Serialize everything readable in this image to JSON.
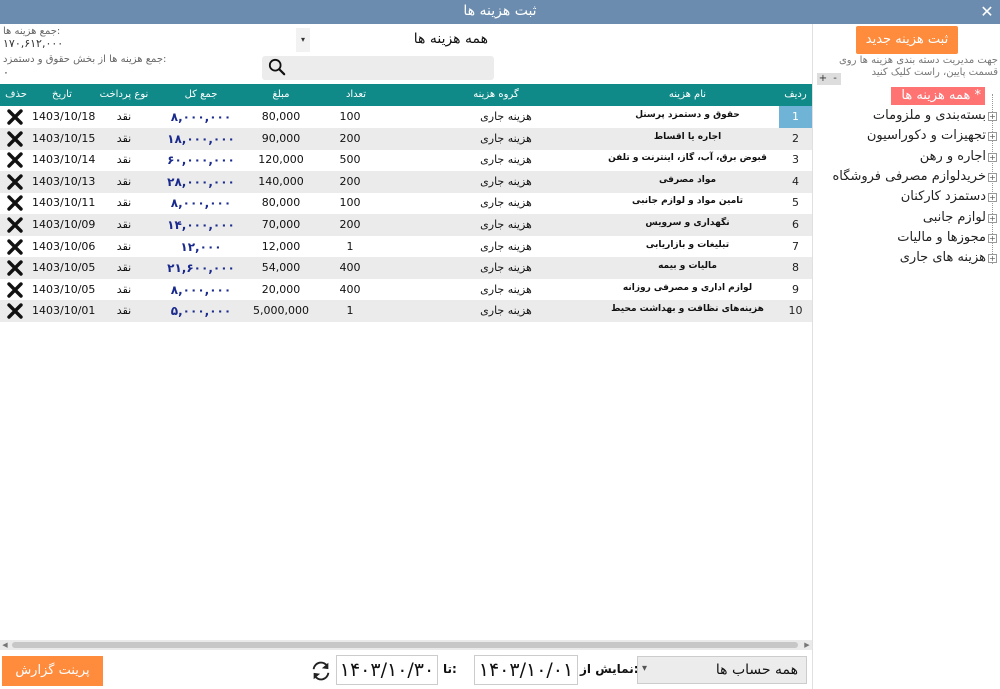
{
  "window": {
    "title": "ثبت هزینه ها",
    "close": "✕"
  },
  "stats": {
    "total_label": "جمع هزینه ها:",
    "total_value": "۱۷۰,۶۱۲,۰۰۰",
    "payroll_label": "جمع هزینه ها از بخش حقوق و دستمزد:",
    "payroll_value": "۰"
  },
  "filter": {
    "selected": "همه هزینه ها",
    "arrow": "▾"
  },
  "search": {
    "value": ""
  },
  "sidebar": {
    "new_button": "ثبت هزینه جدید",
    "hint": "جهت مدیریت دسته بندی هزینه ها روی قسمت پایین، راست کلیک کنید",
    "plus": "+",
    "minus": "-",
    "root": "* همه هزینه ها *",
    "items": [
      "بسته‌بندی و ملزومات",
      "تجهیزات و دکوراسیون",
      "اجاره و رهن",
      "خریدلوازم مصرفی فروشگاه",
      "دستمزد کارکنان",
      "لوازم جانبی",
      "مجوزها و مالیات",
      "هزینه های جاری"
    ]
  },
  "table": {
    "headers": {
      "delete": "حذف",
      "date": "تاریخ",
      "payment": "نوع پرداخت",
      "total": "جمع کل",
      "amount": "مبلغ",
      "count": "تعداد",
      "group": "گروه هزینه",
      "name": "نام هزینه",
      "row": "ردیف"
    },
    "rows": [
      {
        "row": "1",
        "name": "حقوق و دستمزد پرسنل",
        "group": "هزینه جاری",
        "count": "100",
        "amount": "80,000",
        "total": "۸,۰۰۰,۰۰۰",
        "payment": "نقد",
        "date": "1403/10/18"
      },
      {
        "row": "2",
        "name": "اجاره یا اقساط",
        "group": "هزینه جاری",
        "count": "200",
        "amount": "90,000",
        "total": "۱۸,۰۰۰,۰۰۰",
        "payment": "نقد",
        "date": "1403/10/15"
      },
      {
        "row": "3",
        "name": "قبوض برق، آب، گاز، اینترنت و تلفن",
        "group": "هزینه جاری",
        "count": "500",
        "amount": "120,000",
        "total": "۶۰,۰۰۰,۰۰۰",
        "payment": "نقد",
        "date": "1403/10/14"
      },
      {
        "row": "4",
        "name": "مواد مصرفی",
        "group": "هزینه جاری",
        "count": "200",
        "amount": "140,000",
        "total": "۲۸,۰۰۰,۰۰۰",
        "payment": "نقد",
        "date": "1403/10/13"
      },
      {
        "row": "5",
        "name": "تامین مواد و لوازم جانبی",
        "group": "هزینه جاری",
        "count": "100",
        "amount": "80,000",
        "total": "۸,۰۰۰,۰۰۰",
        "payment": "نقد",
        "date": "1403/10/11"
      },
      {
        "row": "6",
        "name": "نگهداری و سرویس",
        "group": "هزینه جاری",
        "count": "200",
        "amount": "70,000",
        "total": "۱۴,۰۰۰,۰۰۰",
        "payment": "نقد",
        "date": "1403/10/09"
      },
      {
        "row": "7",
        "name": "تبلیغات و بازاریابی",
        "group": "هزینه جاری",
        "count": "1",
        "amount": "12,000",
        "total": "۱۲,۰۰۰",
        "payment": "نقد",
        "date": "1403/10/06"
      },
      {
        "row": "8",
        "name": "مالیات و بیمه",
        "group": "هزینه جاری",
        "count": "400",
        "amount": "54,000",
        "total": "۲۱,۶۰۰,۰۰۰",
        "payment": "نقد",
        "date": "1403/10/05"
      },
      {
        "row": "9",
        "name": "لوازم اداری و مصرفی روزانه",
        "group": "هزینه جاری",
        "count": "400",
        "amount": "20,000",
        "total": "۸,۰۰۰,۰۰۰",
        "payment": "نقد",
        "date": "1403/10/05"
      },
      {
        "row": "10",
        "name": "هزینه‌های نظافت و بهداشت محیط",
        "group": "هزینه جاری",
        "count": "1",
        "amount": "5,000,000",
        "total": "۵,۰۰۰,۰۰۰",
        "payment": "نقد",
        "date": "1403/10/01"
      }
    ]
  },
  "footer": {
    "print": "پرینت گزارش",
    "to_label": "تا:",
    "to_date": "۱۴۰۳/۱۰/۳۰",
    "from_label": "نمایش از:",
    "from_date": "۱۴۰۳/۱۰/۰۱",
    "account": "همه حساب ها",
    "account_arrow": "▾"
  },
  "colors": {
    "title_bar": "#6b8cae",
    "header": "#0f8a88",
    "accent": "#ff8b3d",
    "root_node": "#ff7373",
    "selected_row": "#6fb3d6"
  }
}
